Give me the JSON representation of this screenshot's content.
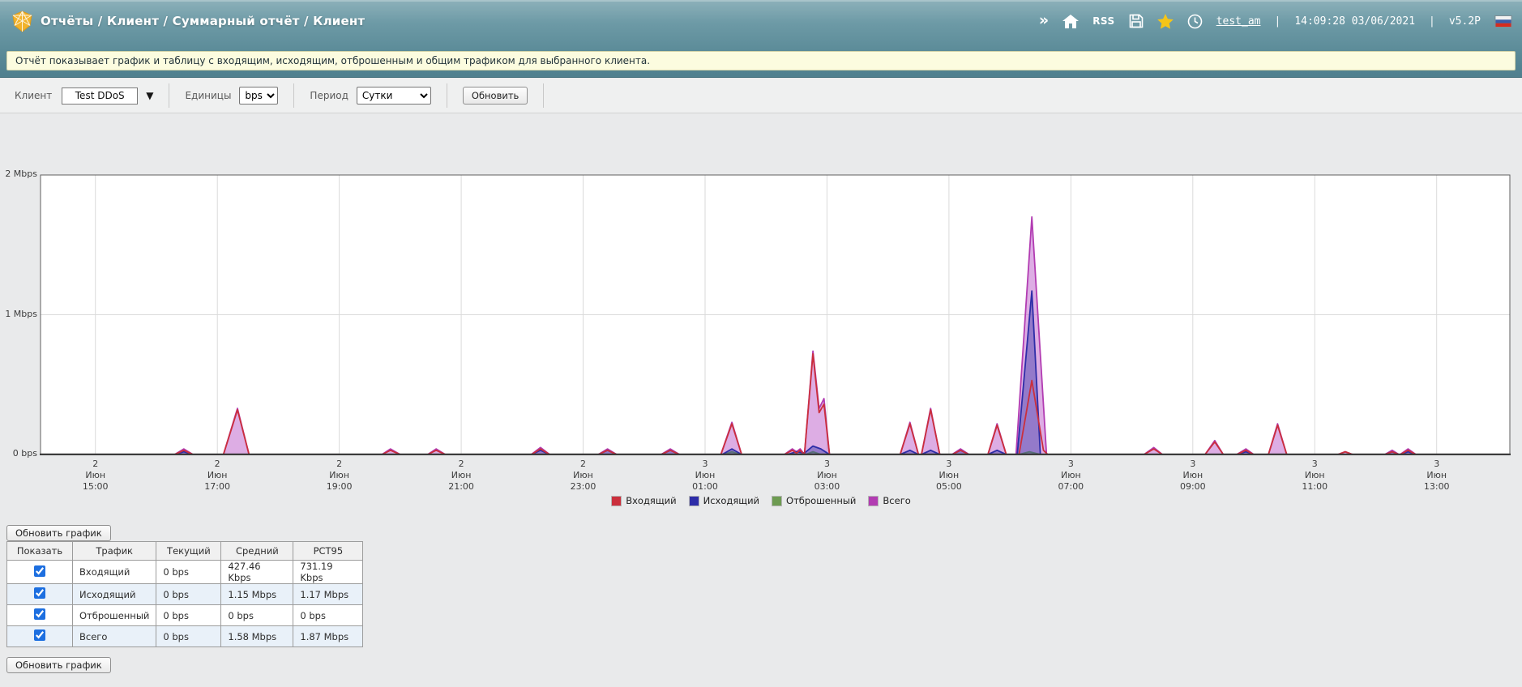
{
  "header": {
    "title": "Отчёты / Клиент / Суммарный отчёт / Клиент",
    "toolbar": {
      "chevrons": "»",
      "rss_label": "RSS",
      "username": "test_am",
      "separator": "|",
      "datetime": "14:09:28 03/06/2021",
      "version": "v5.2P"
    }
  },
  "info_bar": {
    "text": "Отчёт показывает график и таблицу с входящим, исходящим, отброшенным и общим трафиком для выбранного клиента."
  },
  "filters": {
    "client_label": "Клиент",
    "client_value": "Test DDoS",
    "client_arrow": "▼",
    "units_label": "Единицы",
    "units_value": "bps",
    "period_label": "Период",
    "period_value": "Сутки",
    "refresh_button": "Обновить"
  },
  "chart_data": {
    "type": "area",
    "title": "",
    "x_unit": "hours since 02 Jun 2021 14:00",
    "x_range": [
      0.1,
      24.2
    ],
    "y_range_mbps": [
      0,
      2
    ],
    "grid": true,
    "legend_position": "bottom",
    "y_ticks": [
      {
        "v": 2,
        "label": "2 Mbps"
      },
      {
        "v": 1,
        "label": "1 Mbps"
      },
      {
        "v": 0,
        "label": "0 bps"
      }
    ],
    "x_ticks": [
      {
        "h": 1,
        "day": "2",
        "month": "Июн",
        "time": "15:00"
      },
      {
        "h": 3,
        "day": "2",
        "month": "Июн",
        "time": "17:00"
      },
      {
        "h": 5,
        "day": "2",
        "month": "Июн",
        "time": "19:00"
      },
      {
        "h": 7,
        "day": "2",
        "month": "Июн",
        "time": "21:00"
      },
      {
        "h": 9,
        "day": "2",
        "month": "Июн",
        "time": "23:00"
      },
      {
        "h": 11,
        "day": "3",
        "month": "Июн",
        "time": "01:00"
      },
      {
        "h": 13,
        "day": "3",
        "month": "Июн",
        "time": "03:00"
      },
      {
        "h": 15,
        "day": "3",
        "month": "Июн",
        "time": "05:00"
      },
      {
        "h": 17,
        "day": "3",
        "month": "Июн",
        "time": "07:00"
      },
      {
        "h": 19,
        "day": "3",
        "month": "Июн",
        "time": "09:00"
      },
      {
        "h": 21,
        "day": "3",
        "month": "Июн",
        "time": "11:00"
      },
      {
        "h": 23,
        "day": "3",
        "month": "Июн",
        "time": "13:00"
      }
    ],
    "series": [
      {
        "key": "incoming",
        "name": "Входящий",
        "color": "#cb2f3c",
        "fill": "none",
        "points": [
          [
            0.1,
            0
          ],
          [
            2.3,
            0
          ],
          [
            2.45,
            0.03
          ],
          [
            2.6,
            0
          ],
          [
            3.1,
            0
          ],
          [
            3.33,
            0.32
          ],
          [
            3.52,
            0
          ],
          [
            5.7,
            0
          ],
          [
            5.84,
            0.03
          ],
          [
            6.0,
            0
          ],
          [
            6.45,
            0
          ],
          [
            6.59,
            0.03
          ],
          [
            6.74,
            0
          ],
          [
            8.15,
            0
          ],
          [
            8.3,
            0.04
          ],
          [
            8.45,
            0
          ],
          [
            9.25,
            0
          ],
          [
            9.4,
            0.03
          ],
          [
            9.55,
            0
          ],
          [
            10.28,
            0
          ],
          [
            10.43,
            0.03
          ],
          [
            10.58,
            0
          ],
          [
            11.26,
            0
          ],
          [
            11.44,
            0.22
          ],
          [
            11.6,
            0
          ],
          [
            12.3,
            0
          ],
          [
            12.43,
            0.03
          ],
          [
            12.5,
            0.01
          ],
          [
            12.56,
            0.03
          ],
          [
            12.63,
            0
          ],
          [
            12.77,
            0.72
          ],
          [
            12.87,
            0.3
          ],
          [
            12.95,
            0.36
          ],
          [
            13.04,
            0
          ],
          [
            14.2,
            0
          ],
          [
            14.36,
            0.22
          ],
          [
            14.5,
            0
          ],
          [
            14.55,
            0
          ],
          [
            14.7,
            0.32
          ],
          [
            14.85,
            0
          ],
          [
            15.05,
            0
          ],
          [
            15.19,
            0.03
          ],
          [
            15.33,
            0
          ],
          [
            15.64,
            0
          ],
          [
            15.79,
            0.21
          ],
          [
            15.94,
            0
          ],
          [
            16.15,
            0
          ],
          [
            16.36,
            0.53
          ],
          [
            16.55,
            0.03
          ],
          [
            16.62,
            0
          ],
          [
            18.2,
            0
          ],
          [
            18.36,
            0.04
          ],
          [
            18.5,
            0
          ],
          [
            19.2,
            0
          ],
          [
            19.36,
            0.09
          ],
          [
            19.5,
            0
          ],
          [
            19.72,
            0
          ],
          [
            19.87,
            0.03
          ],
          [
            20.0,
            0
          ],
          [
            20.24,
            0
          ],
          [
            20.39,
            0.21
          ],
          [
            20.54,
            0
          ],
          [
            21.38,
            0
          ],
          [
            21.5,
            0.02
          ],
          [
            21.62,
            0
          ],
          [
            22.15,
            0
          ],
          [
            22.27,
            0.02
          ],
          [
            22.38,
            0
          ],
          [
            22.4,
            0
          ],
          [
            22.53,
            0.03
          ],
          [
            22.66,
            0
          ],
          [
            24.2,
            0
          ]
        ]
      },
      {
        "key": "outgoing",
        "name": "Исходящий",
        "color": "#2d2da8",
        "fill": "rgba(60,60,170,0.45)",
        "points": [
          [
            0.1,
            0
          ],
          [
            2.3,
            0
          ],
          [
            2.45,
            0.02
          ],
          [
            2.6,
            0
          ],
          [
            8.15,
            0
          ],
          [
            8.3,
            0.03
          ],
          [
            8.45,
            0
          ],
          [
            9.25,
            0
          ],
          [
            9.4,
            0.03
          ],
          [
            9.55,
            0
          ],
          [
            10.28,
            0
          ],
          [
            10.43,
            0.03
          ],
          [
            10.58,
            0
          ],
          [
            11.28,
            0
          ],
          [
            11.44,
            0.04
          ],
          [
            11.6,
            0
          ],
          [
            12.35,
            0
          ],
          [
            12.5,
            0.02
          ],
          [
            12.63,
            0.01
          ],
          [
            12.77,
            0.06
          ],
          [
            12.9,
            0.04
          ],
          [
            13.04,
            0
          ],
          [
            14.2,
            0
          ],
          [
            14.36,
            0.03
          ],
          [
            14.5,
            0
          ],
          [
            14.55,
            0
          ],
          [
            14.7,
            0.03
          ],
          [
            14.85,
            0
          ],
          [
            15.05,
            0
          ],
          [
            15.19,
            0.03
          ],
          [
            15.33,
            0
          ],
          [
            15.64,
            0
          ],
          [
            15.79,
            0.03
          ],
          [
            15.94,
            0
          ],
          [
            16.12,
            0
          ],
          [
            16.36,
            1.17
          ],
          [
            16.5,
            0
          ],
          [
            19.72,
            0
          ],
          [
            19.87,
            0.02
          ],
          [
            20.0,
            0
          ],
          [
            22.15,
            0
          ],
          [
            22.27,
            0.02
          ],
          [
            22.38,
            0
          ],
          [
            22.4,
            0
          ],
          [
            22.53,
            0.02
          ],
          [
            22.66,
            0
          ],
          [
            24.2,
            0
          ]
        ]
      },
      {
        "key": "dropped",
        "name": "Отброшенный",
        "color": "#6d9b51",
        "fill": "rgba(110,150,80,0.5)",
        "points": [
          [
            0.1,
            0
          ],
          [
            11.3,
            0
          ],
          [
            11.44,
            0.02
          ],
          [
            11.58,
            0
          ],
          [
            12.65,
            0
          ],
          [
            12.77,
            0.02
          ],
          [
            12.9,
            0
          ],
          [
            16.15,
            0
          ],
          [
            16.32,
            0.02
          ],
          [
            16.5,
            0
          ],
          [
            24.2,
            0
          ]
        ]
      },
      {
        "key": "total",
        "name": "Всего",
        "color": "#b23cb2",
        "fill": "rgba(193,105,205,0.55)",
        "points": [
          [
            0.1,
            0
          ],
          [
            2.3,
            0
          ],
          [
            2.45,
            0.04
          ],
          [
            2.6,
            0
          ],
          [
            3.1,
            0
          ],
          [
            3.33,
            0.33
          ],
          [
            3.52,
            0
          ],
          [
            5.7,
            0
          ],
          [
            5.84,
            0.04
          ],
          [
            6.0,
            0
          ],
          [
            6.45,
            0
          ],
          [
            6.59,
            0.04
          ],
          [
            6.74,
            0
          ],
          [
            8.15,
            0
          ],
          [
            8.3,
            0.05
          ],
          [
            8.45,
            0
          ],
          [
            9.25,
            0
          ],
          [
            9.4,
            0.04
          ],
          [
            9.55,
            0
          ],
          [
            10.28,
            0
          ],
          [
            10.43,
            0.04
          ],
          [
            10.58,
            0
          ],
          [
            11.26,
            0
          ],
          [
            11.44,
            0.23
          ],
          [
            11.6,
            0
          ],
          [
            12.3,
            0
          ],
          [
            12.43,
            0.04
          ],
          [
            12.5,
            0.02
          ],
          [
            12.56,
            0.04
          ],
          [
            12.63,
            0
          ],
          [
            12.77,
            0.74
          ],
          [
            12.87,
            0.33
          ],
          [
            12.95,
            0.4
          ],
          [
            13.04,
            0
          ],
          [
            14.2,
            0
          ],
          [
            14.36,
            0.23
          ],
          [
            14.5,
            0
          ],
          [
            14.55,
            0
          ],
          [
            14.7,
            0.33
          ],
          [
            14.85,
            0
          ],
          [
            15.05,
            0
          ],
          [
            15.19,
            0.04
          ],
          [
            15.33,
            0
          ],
          [
            15.64,
            0
          ],
          [
            15.79,
            0.22
          ],
          [
            15.94,
            0
          ],
          [
            16.1,
            0
          ],
          [
            16.36,
            1.7
          ],
          [
            16.6,
            0
          ],
          [
            18.2,
            0
          ],
          [
            18.36,
            0.05
          ],
          [
            18.5,
            0
          ],
          [
            19.2,
            0
          ],
          [
            19.36,
            0.1
          ],
          [
            19.5,
            0
          ],
          [
            19.72,
            0
          ],
          [
            19.87,
            0.04
          ],
          [
            20.0,
            0
          ],
          [
            20.24,
            0
          ],
          [
            20.39,
            0.22
          ],
          [
            20.54,
            0
          ],
          [
            21.38,
            0
          ],
          [
            21.5,
            0.02
          ],
          [
            21.62,
            0
          ],
          [
            22.15,
            0
          ],
          [
            22.27,
            0.03
          ],
          [
            22.38,
            0
          ],
          [
            22.4,
            0
          ],
          [
            22.53,
            0.04
          ],
          [
            22.66,
            0
          ],
          [
            24.2,
            0
          ]
        ]
      }
    ]
  },
  "table": {
    "refresh_top": "Обновить график",
    "refresh_bottom": "Обновить график",
    "columns": [
      "Показать",
      "Трафик",
      "Текущий",
      "Средний",
      "PCT95"
    ],
    "rows": [
      {
        "checked": true,
        "traffic": "Входящий",
        "current": "0 bps",
        "average": "427.46 Kbps",
        "pct95": "731.19 Kbps"
      },
      {
        "checked": true,
        "traffic": "Исходящий",
        "current": "0 bps",
        "average": "1.15 Mbps",
        "pct95": "1.17 Mbps"
      },
      {
        "checked": true,
        "traffic": "Отброшенный",
        "current": "0 bps",
        "average": "0 bps",
        "pct95": "0 bps"
      },
      {
        "checked": true,
        "traffic": "Всего",
        "current": "0 bps",
        "average": "1.58 Mbps",
        "pct95": "1.87 Mbps"
      }
    ]
  },
  "colors": {
    "header_top": "#8db1ba",
    "header_bottom": "#4f7f8e",
    "info_bg": "#fcfcdf",
    "page_bg": "#e9eaeb",
    "star": "#f5c518",
    "logo": "#f2b32c",
    "checkbox_accent": "#1d6fe0",
    "flag_white": "#f2f2f2",
    "flag_blue": "#3a5ba8",
    "flag_red": "#d52b1e"
  }
}
